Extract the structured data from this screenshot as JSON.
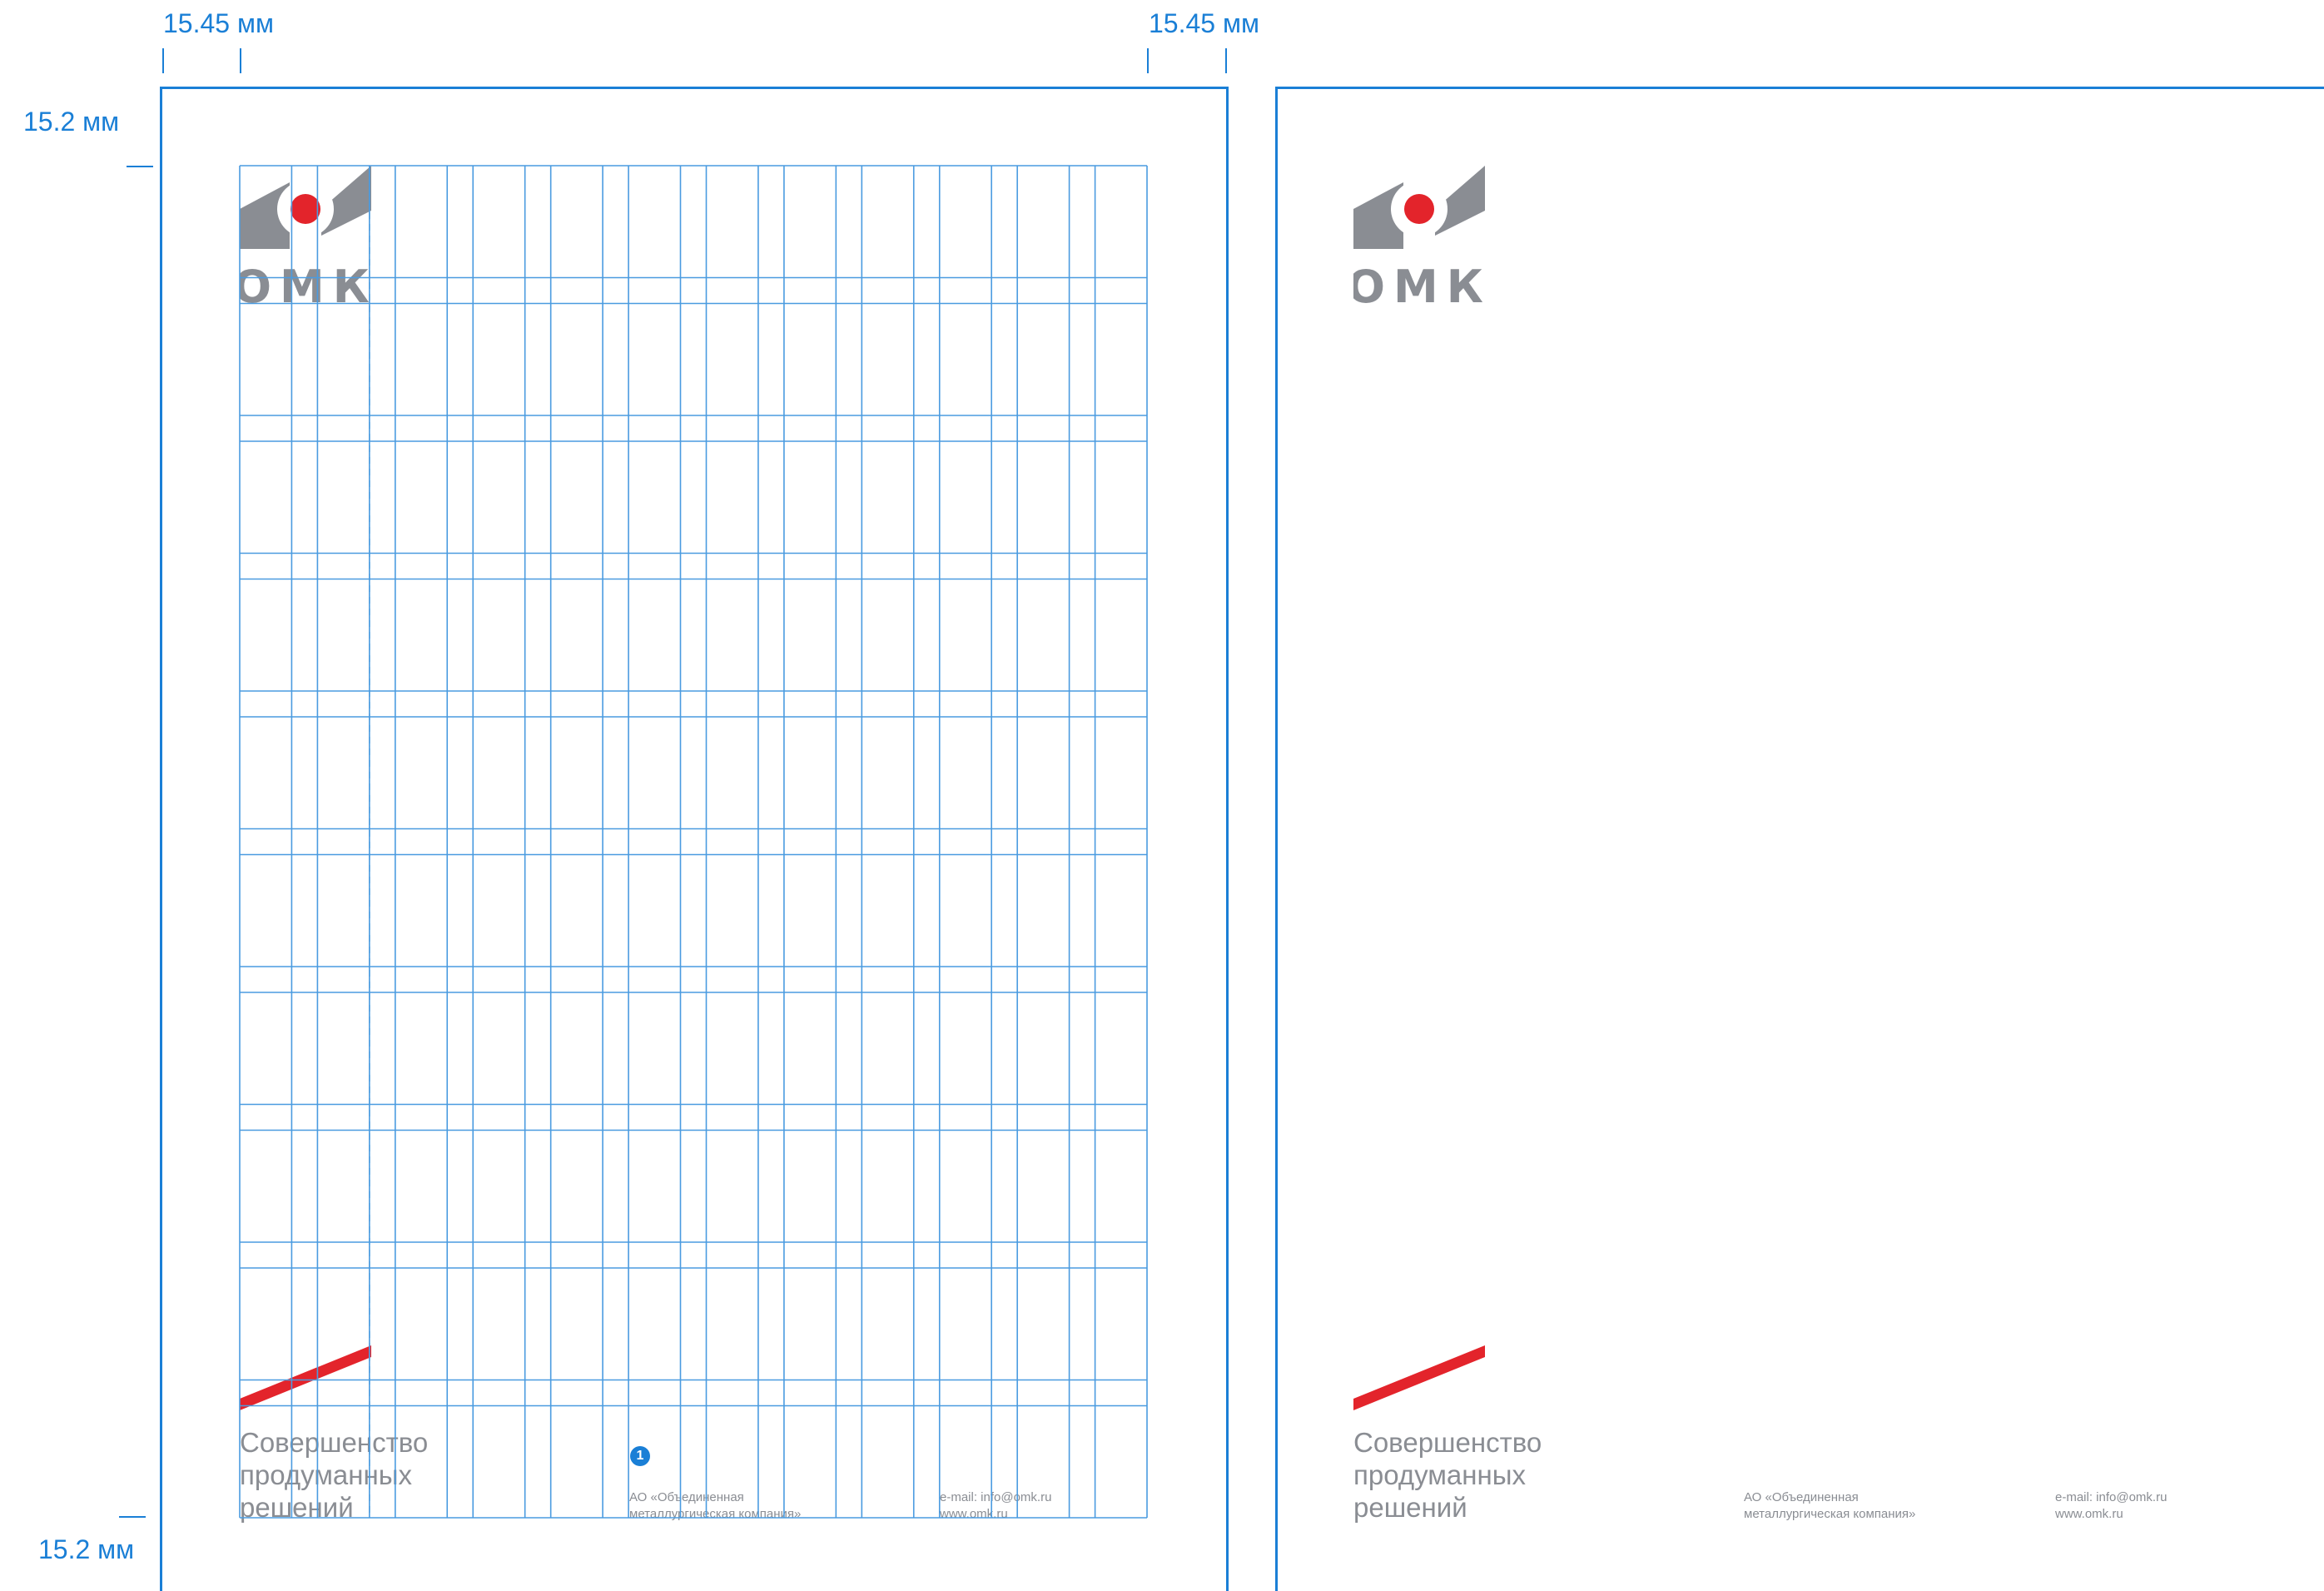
{
  "dimensions": {
    "left_margin": "15.45 мм",
    "right_margin": "15.45 мм",
    "top_margin": "15.2 мм",
    "bottom_margin": "15.2 мм"
  },
  "logo": {
    "text": "ОМК",
    "icon": "omk-logo-icon",
    "gray": "#8a8d93",
    "red": "#e3242b"
  },
  "slogan": {
    "line1": "Совершенство",
    "line2": "продуманных",
    "line3": "решений"
  },
  "footer": {
    "company_line1": "АО «Объединенная",
    "company_line2": "металлургическая компания»",
    "email": "e-mail: info@omk.ru",
    "website": "www.omk.ru"
  },
  "annotation": {
    "number": "1"
  },
  "colors": {
    "guide_blue": "#1a7fd6",
    "grid_blue": "#4a9be0",
    "accent_red": "#e3242b",
    "text_gray": "#8a8d93"
  }
}
